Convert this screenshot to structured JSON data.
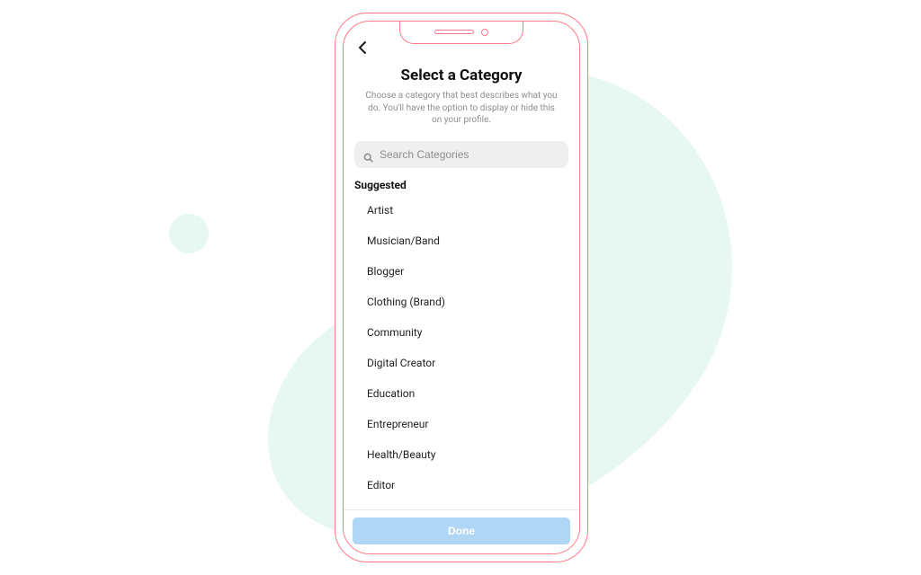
{
  "colors": {
    "background_blob": "#e7f8f3",
    "phone_outline": "#ff7a86",
    "button": "#b0d6f5",
    "muted_text": "#8e8e8e",
    "search_bg": "#efefef"
  },
  "header": {
    "back_icon": "chevron-left",
    "title": "Select a Category",
    "subtitle": "Choose a category that best describes what you do. You'll have the option to display or hide this on your profile."
  },
  "search": {
    "placeholder": "Search Categories",
    "value": ""
  },
  "suggested": {
    "label": "Suggested",
    "items": [
      "Artist",
      "Musician/Band",
      "Blogger",
      "Clothing (Brand)",
      "Community",
      "Digital Creator",
      "Education",
      "Entrepreneur",
      "Health/Beauty",
      "Editor"
    ]
  },
  "footer": {
    "done_label": "Done"
  }
}
